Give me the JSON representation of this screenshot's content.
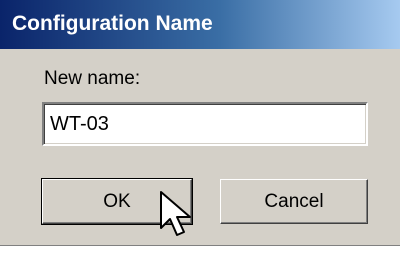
{
  "dialog": {
    "title": "Configuration Name",
    "name_label": "New name:",
    "name_value": "WT-03",
    "ok_label": "OK",
    "cancel_label": "Cancel"
  },
  "cursor": {
    "icon": "arrow-cursor-icon"
  },
  "colors": {
    "title_start": "#0a246a",
    "title_end": "#a6caf0",
    "face": "#d4d0c8"
  }
}
